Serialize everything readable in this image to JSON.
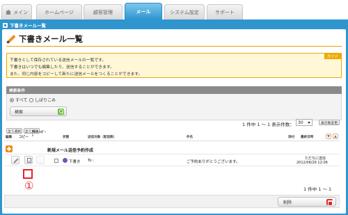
{
  "nav": {
    "tabs": [
      {
        "label": "メイン"
      },
      {
        "label": "ホームページ"
      },
      {
        "label": "顧客管理"
      },
      {
        "label": "メール"
      },
      {
        "label": "システム設定"
      },
      {
        "label": "サポート"
      }
    ],
    "active": "メール",
    "accent_color": "#2f95cf"
  },
  "frame": {
    "title": "下書きメール一覧"
  },
  "page": {
    "title": "下書きメール一覧"
  },
  "guide": {
    "badge": "ガイド",
    "lines": [
      "下書きとして保存されている送信メールの一覧です。",
      "下書きはいつでも編集したり、送信することができます。",
      "また、同じ内容をコピーして新たに送信メールをつくることができます。"
    ]
  },
  "filter": {
    "header": "検索条件",
    "options": [
      "すべて",
      "しぼりこみ"
    ],
    "selected": "すべて",
    "search_label": "検索"
  },
  "toolbar": {
    "select_all": "全て選択",
    "deselect_all": "全て解除",
    "count_text": "1 件中 1 ～ 1",
    "per_page_label": "表示件数：",
    "per_page_value": "30",
    "change_label": "表示数変更"
  },
  "table": {
    "headers": {
      "edit": "編集",
      "copy": "コピー",
      "create_from": "ｸﾘｯｸ ﾚﾎﾟｰﾄ",
      "status": "状態",
      "recipient": "送信対象（配信数）",
      "subject": "件名",
      "attach": "添付",
      "updated": "最終日時"
    },
    "new_row_label": "新規メール送信予約作成",
    "rows": [
      {
        "status": "下書き",
        "recipient": "To :",
        "subject": "ご予約ありがとうございます。",
        "action_text": "ただちに送信",
        "date": "2012/06/29 12:06"
      }
    ]
  },
  "annotation": {
    "marker": "①",
    "color": "#e3242b"
  },
  "footer": {
    "count_text": "1 件中 1 ～ 1",
    "delete_label": "削除"
  }
}
